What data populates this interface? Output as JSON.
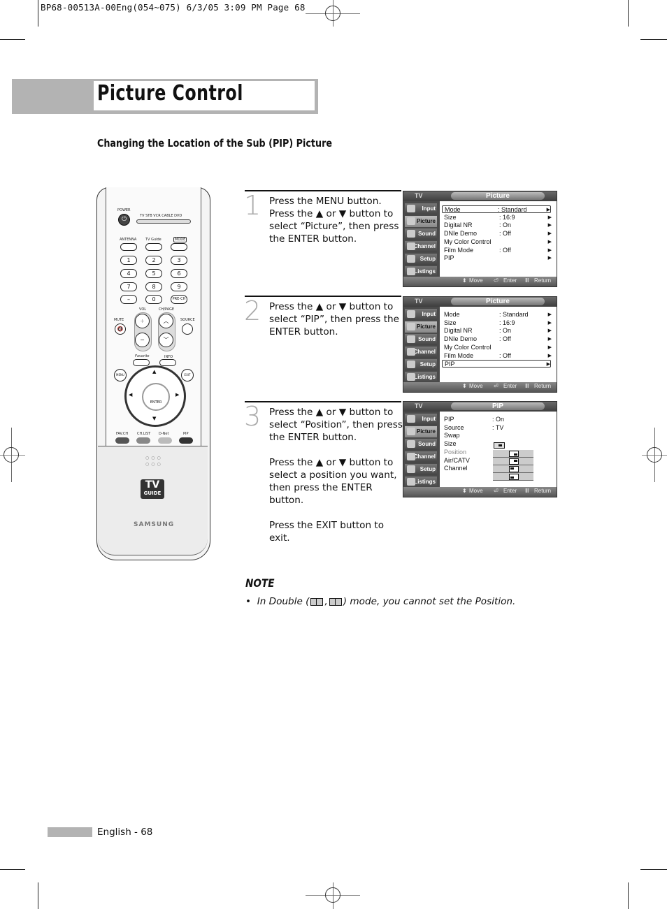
{
  "print_slug": "BP68-00513A-00Eng(054~075)   6/3/05   3:09 PM   Page 68",
  "page_title": "Picture Control",
  "section_title": "Changing the Location of the Sub (PIP) Picture",
  "remote": {
    "labels": {
      "power": "POWER",
      "modes": "TV  STB  VCR  CABLE  DVD",
      "antenna": "ANTENNA",
      "tv_guide": "TV Guide",
      "mode": "MODE",
      "vol": "VOL",
      "ch_page": "CH/PAGE",
      "mute": "MUTE",
      "source": "SOURCE",
      "favorite": "Favorite",
      "info": "INFO",
      "menu": "MENU",
      "exit": "EXIT",
      "enter": "ENTER",
      "fav_ch": "FAV.CH",
      "ch_list": "CH.LIST",
      "d_net": "D-Net",
      "pip": "PIP",
      "prech": "PRE-CH",
      "dash": "–",
      "brand": "SAMSUNG",
      "tvguide_logo_top": "TV",
      "tvguide_logo_bottom": "GUIDE"
    },
    "number_keys": [
      "1",
      "2",
      "3",
      "4",
      "5",
      "6",
      "7",
      "8",
      "9"
    ],
    "zero_key": "0",
    "button_colors": {
      "fav_ch": "#555555",
      "ch_list": "#888888",
      "d_net": "#bbbbbb",
      "pip": "#333333"
    }
  },
  "steps": [
    {
      "number": "1",
      "paragraphs": [
        "Press the MENU button. Press the ▲ or ▼ button to select “Picture”, then press the ENTER button."
      ]
    },
    {
      "number": "2",
      "paragraphs": [
        "Press the ▲ or ▼ button to select “PIP”, then press the ENTER button."
      ]
    },
    {
      "number": "3",
      "paragraphs": [
        "Press the ▲ or ▼ button to select “Position”, then press the ENTER button.",
        "Press the ▲ or ▼ button to select a position you want, then press the ENTER button.",
        "Press the EXIT button to exit."
      ]
    }
  ],
  "osd_common": {
    "source_label": "TV",
    "sidebar": [
      "Input",
      "Picture",
      "Sound",
      "Channel",
      "Setup",
      "Listings"
    ],
    "footer": {
      "move": "Move",
      "enter": "Enter",
      "return": "Return"
    },
    "arrow": "▶"
  },
  "osd_screens": [
    {
      "title": "Picture",
      "active_sidebar": "Picture",
      "rows": [
        {
          "label": "Mode",
          "value": ": Standard",
          "arrow": true,
          "selected": true
        },
        {
          "label": "Size",
          "value": ": 16:9",
          "arrow": true
        },
        {
          "label": "Digital NR",
          "value": ": On",
          "arrow": true
        },
        {
          "label": "DNIe Demo",
          "value": ": Off",
          "arrow": true
        },
        {
          "label": "My Color Control",
          "value": "",
          "arrow": true
        },
        {
          "label": "Film Mode",
          "value": ": Off",
          "arrow": true
        },
        {
          "label": "PIP",
          "value": "",
          "arrow": true
        }
      ]
    },
    {
      "title": "Picture",
      "active_sidebar": "Picture",
      "rows": [
        {
          "label": "Mode",
          "value": ": Standard",
          "arrow": true
        },
        {
          "label": "Size",
          "value": ": 16:9",
          "arrow": true
        },
        {
          "label": "Digital NR",
          "value": ": On",
          "arrow": true
        },
        {
          "label": "DNIe Demo",
          "value": ": Off",
          "arrow": true
        },
        {
          "label": "My Color Control",
          "value": "",
          "arrow": true
        },
        {
          "label": "Film Mode",
          "value": ": Off",
          "arrow": true
        },
        {
          "label": "PIP",
          "value": "",
          "arrow": true,
          "selected": true
        }
      ]
    },
    {
      "title": "PIP",
      "active_sidebar": "Picture",
      "rows": [
        {
          "label": "PIP",
          "value": ": On"
        },
        {
          "label": "Source",
          "value": ": TV"
        },
        {
          "label": "Swap",
          "value": ""
        },
        {
          "label": "Size",
          "value": ""
        },
        {
          "label": "Position",
          "value": "",
          "dim": true
        },
        {
          "label": "Air/CATV",
          "value": ""
        },
        {
          "label": "Channel",
          "value": ""
        }
      ],
      "position_options": [
        "bottom-right",
        "top-right",
        "top-left",
        "bottom-left"
      ]
    }
  ],
  "note": {
    "title": "NOTE",
    "bullet": "•",
    "text_before": "In Double (",
    "separator": ",",
    "text_after": ") mode, you cannot set the Position."
  },
  "footer": {
    "page_label": "English - 68"
  }
}
